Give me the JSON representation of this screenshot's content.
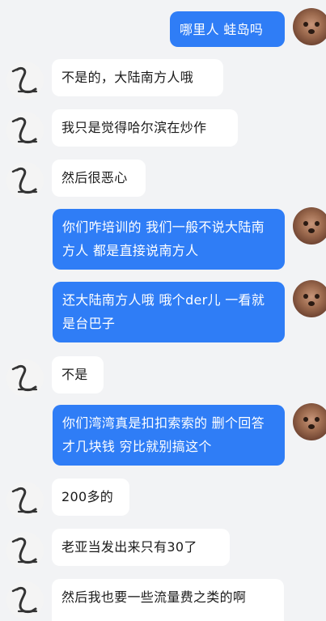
{
  "conversation": {
    "messages": [
      {
        "side": "out",
        "text": "哪里人 蛙岛吗",
        "avatar": "dog-avatar"
      },
      {
        "side": "in",
        "text": "不是的，大陆南方人哦",
        "avatar": "swan-avatar"
      },
      {
        "side": "in",
        "text": "我只是觉得哈尔滨在炒作",
        "avatar": "swan-avatar"
      },
      {
        "side": "in",
        "text": "然后很恶心",
        "avatar": "swan-avatar"
      },
      {
        "side": "out",
        "text": "你们咋培训的 我们一般不说大陆南方人 都是直接说南方人",
        "avatar": "dog-avatar"
      },
      {
        "side": "out",
        "text": "还大陆南方人哦 哦个der儿 一看就是台巴子",
        "avatar": "dog-avatar"
      },
      {
        "side": "in",
        "text": "不是",
        "avatar": "swan-avatar"
      },
      {
        "side": "out",
        "text": "你们湾湾真是扣扣索索的 删个回答才几块钱 穷比就别搞这个",
        "avatar": "dog-avatar"
      },
      {
        "side": "in",
        "text": "200多的",
        "avatar": "swan-avatar"
      },
      {
        "side": "in",
        "text": "老亚当发出来只有30了",
        "avatar": "swan-avatar"
      },
      {
        "side": "in",
        "text": "然后我也要一些流量费之类的啊",
        "avatar": "swan-avatar"
      }
    ]
  },
  "colors": {
    "background": "#f2f3f5",
    "incoming_bubble": "#ffffff",
    "outgoing_bubble": "#2f7df6"
  }
}
